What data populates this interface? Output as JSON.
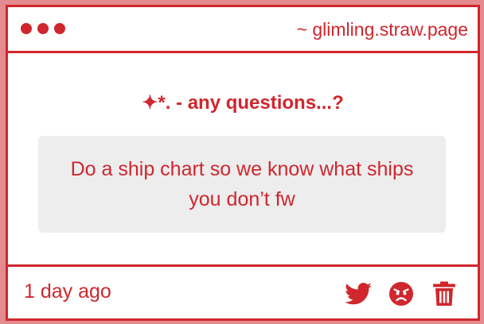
{
  "window": {
    "url": "~ glimling.straw.page"
  },
  "main": {
    "heading": "✦*. - any questions...?",
    "question": "Do a ship chart so we know what ships you don’t fw"
  },
  "footer": {
    "timestamp": "1 day ago",
    "icons": [
      "twitter-icon",
      "angry-face-icon",
      "trash-icon"
    ]
  },
  "colors": {
    "accent": "#d0262d",
    "page_background": "#e58b8f",
    "card_background": "#ffffff",
    "question_background": "#ededee"
  }
}
